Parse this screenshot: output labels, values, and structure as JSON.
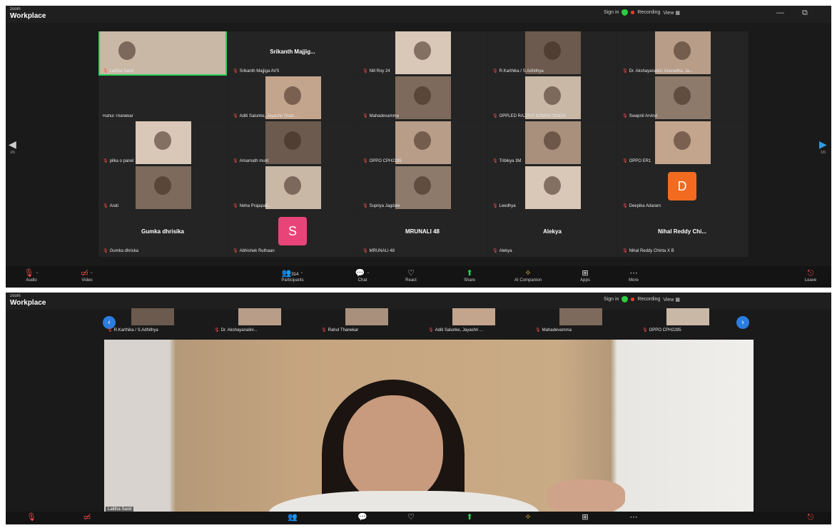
{
  "app": {
    "brand_small": "zoom",
    "brand_name": "Workplace"
  },
  "titlebar": {
    "sign_in": "Sign in",
    "recording": "Recording",
    "view": "View",
    "minimize": "—",
    "maximize": "⧉",
    "close": "✕"
  },
  "gallery": {
    "page_left": "◀",
    "page_left_num": "1/6",
    "page_right": "▶",
    "page_right_num": "1/6",
    "tiles": [
      {
        "name": "Lalitha Sarid",
        "video": true,
        "active": true
      },
      {
        "name": "Srikanth Majjiga AVS",
        "big_name": "Srikanth Majjig...",
        "video": false
      },
      {
        "name": "Nill Roy 24",
        "video": true
      },
      {
        "name": "R.Karthika / S.Adhithya",
        "video": true
      },
      {
        "name": "Dr. Akshayanalini, Anuradha, Ja...",
        "video": true
      },
      {
        "name": "Rahul Thanekar",
        "video": false,
        "no_mic": true
      },
      {
        "name": "Aditi Salunke, Jayashri Shah...",
        "video": true
      },
      {
        "name": "Mahadevamma",
        "video": true
      },
      {
        "name": "OPPLED RAJPUT SUMAN SINGH",
        "video": true
      },
      {
        "name": "Swapnil Arvind",
        "video": true
      },
      {
        "name": "pilka o panel",
        "video": true
      },
      {
        "name": "Amarnath mukt",
        "video": true
      },
      {
        "name": "OPPO CPH2285",
        "video": true
      },
      {
        "name": "Tribikya 3M",
        "video": true
      },
      {
        "name": "OPPO ER1",
        "video": true
      },
      {
        "name": "Arati",
        "video": true
      },
      {
        "name": "Neha Prajapati...",
        "video": true
      },
      {
        "name": "Supriya Jagdale",
        "video": true
      },
      {
        "name": "Leedhya",
        "video": true
      },
      {
        "name": "Deepika Adaram",
        "avatar_letter": "D",
        "video": false
      },
      {
        "name": "Gumka dhriska",
        "big_name": "Gumka dhrisika",
        "video": false
      },
      {
        "name": "Abhishek Ruthaan",
        "avatar_letter": "S",
        "video": false
      },
      {
        "name": "MRUNALI 48",
        "big_name": "MRUNALI 48",
        "video": false
      },
      {
        "name": "Alekya",
        "big_name": "Alekya",
        "video": false
      },
      {
        "name": "Nihal Reddy Chinta X B",
        "big_name": "Nihal Reddy Chi...",
        "video": false
      }
    ]
  },
  "toolbar": {
    "audio": "Audio",
    "video": "Video",
    "participants": "Participants",
    "participants_count": "314",
    "chat": "Chat",
    "react": "React",
    "share": "Share",
    "ai_companion": "AI Companion",
    "apps": "Apps",
    "more": "More",
    "leave": "Leave"
  },
  "speaker_view": {
    "strip": [
      {
        "name": "R.Karthika / S.Adhithya"
      },
      {
        "name": "Dr. Akshayanalini..."
      },
      {
        "name": "Rahul Thanekar"
      },
      {
        "name": "Aditi Salunke, Jayashri ..."
      },
      {
        "name": "Mahadevamma"
      },
      {
        "name": "OPPO CPH2285"
      }
    ],
    "speaker_name": "Lalitha Sarid",
    "prev": "‹",
    "next": "›"
  },
  "colors": {
    "active_border": "#2fd15a",
    "record_dot": "#ff3b30",
    "leave": "#e02424",
    "avatar_d": "#f26b21",
    "avatar_s": "#e8447a",
    "nav_blue": "#2b7de0"
  },
  "icons": {
    "audio": "mic-muted-icon",
    "video": "camera-off-icon",
    "participants": "people-icon",
    "chat": "chat-bubble-icon",
    "react": "heart-icon",
    "share": "share-screen-icon",
    "ai_companion": "sparkle-icon",
    "apps": "apps-grid-icon",
    "more": "more-dots-icon",
    "leave": "door-leave-icon"
  }
}
